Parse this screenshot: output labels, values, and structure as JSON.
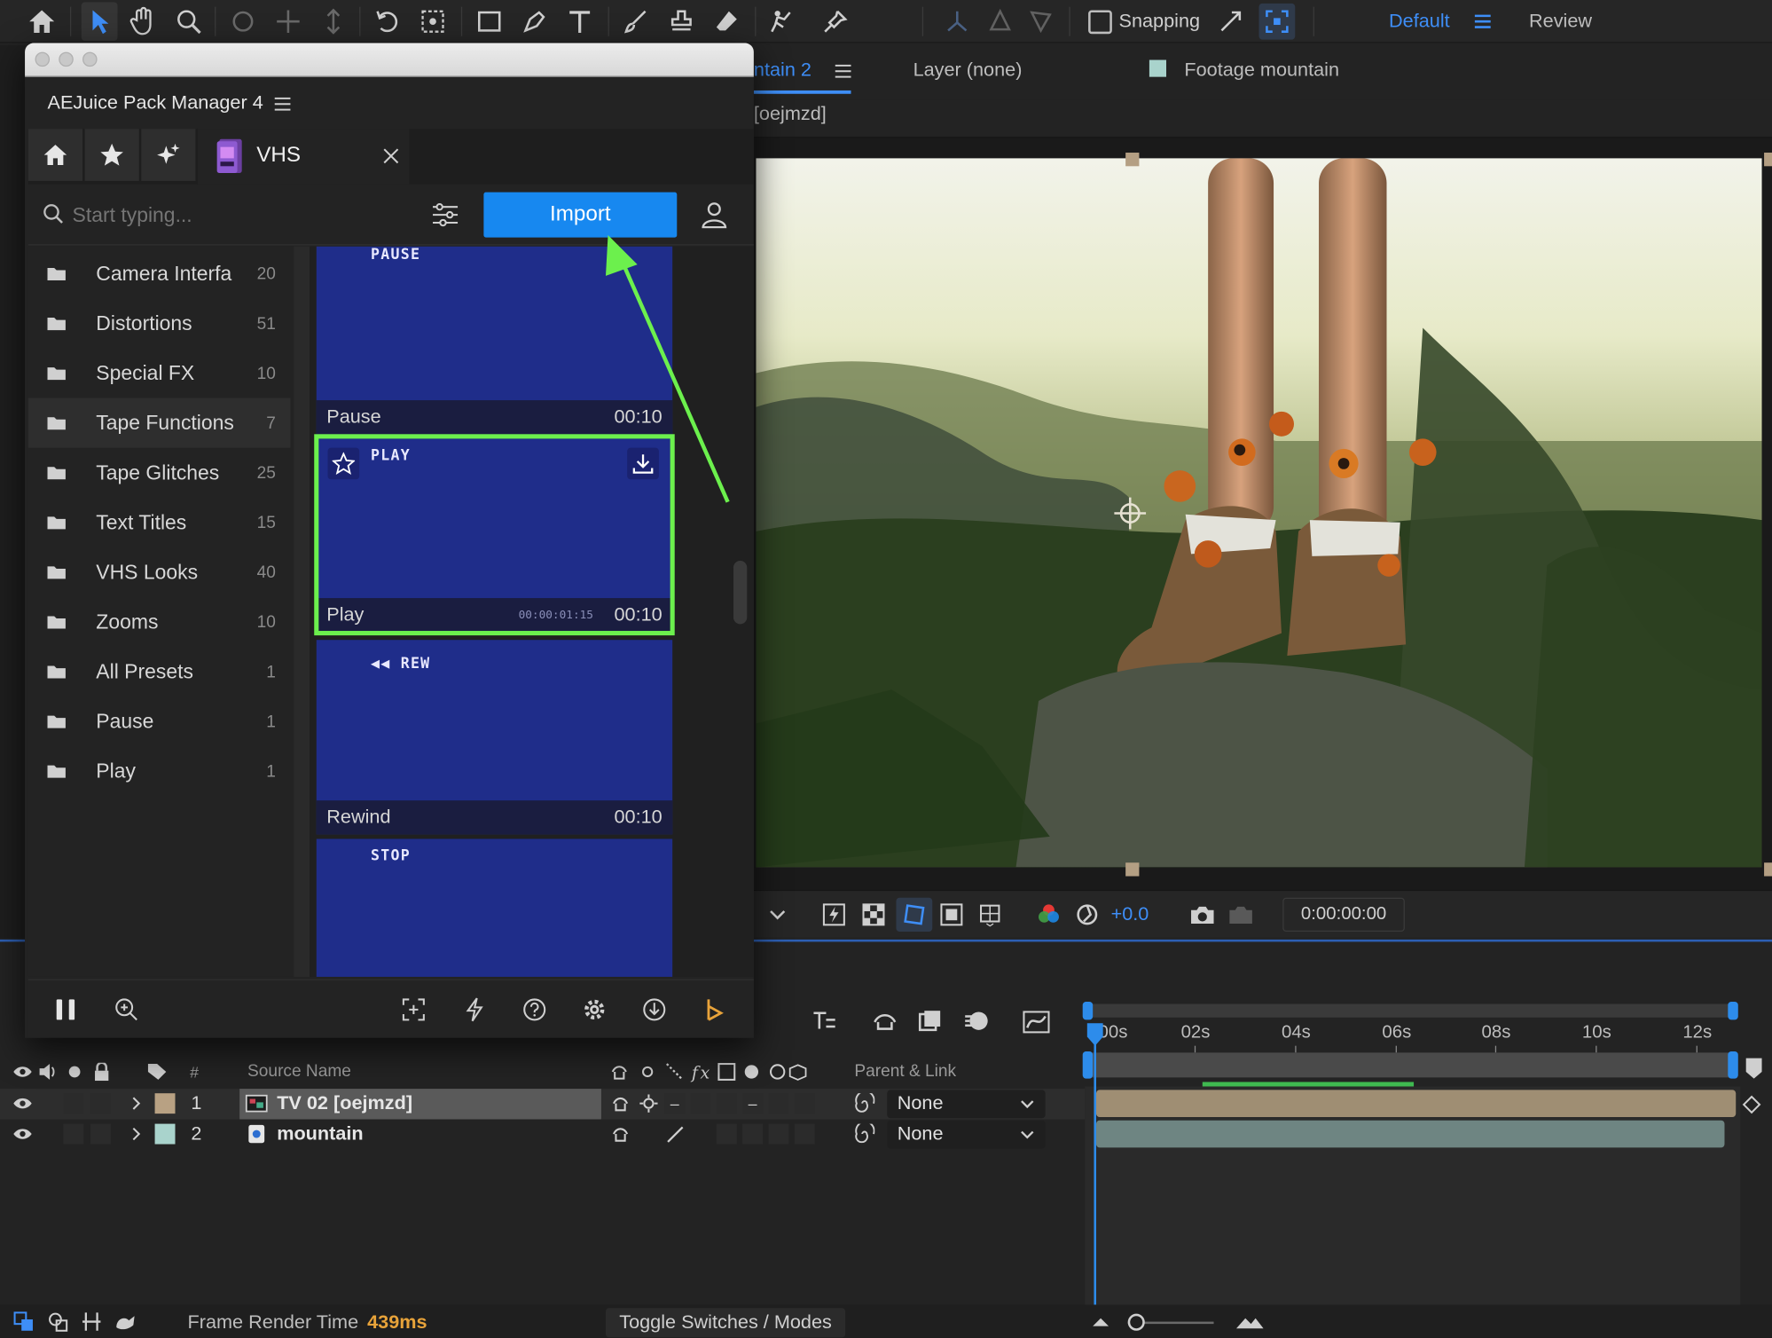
{
  "toolbar": {
    "snapping_label": "Snapping",
    "workspace_default": "Default",
    "workspace_review": "Review"
  },
  "comp": {
    "tab_name": "ntain 2",
    "layer_tab": "Layer (none)",
    "footage_tab": "Footage mountain",
    "sub_label": "[oejmzd]"
  },
  "viewer": {
    "exposure": "+0.0",
    "timecode": "0:00:00:00"
  },
  "plugin": {
    "title": "AEJuice Pack Manager 4",
    "pack_tab": "VHS",
    "search_placeholder": "Start typing...",
    "import_label": "Import",
    "categories": [
      {
        "name": "Camera Interfa",
        "count": "20"
      },
      {
        "name": "Distortions",
        "count": "51"
      },
      {
        "name": "Special FX",
        "count": "10"
      },
      {
        "name": "Tape Functions",
        "count": "7"
      },
      {
        "name": "Tape Glitches",
        "count": "25"
      },
      {
        "name": "Text Titles",
        "count": "15"
      },
      {
        "name": "VHS Looks",
        "count": "40"
      },
      {
        "name": "Zooms",
        "count": "10"
      },
      {
        "name": "All Presets",
        "count": "1"
      },
      {
        "name": "Pause",
        "count": "1"
      },
      {
        "name": "Play",
        "count": "1"
      }
    ],
    "presets": [
      {
        "overlay": "PAUSE",
        "name": "Pause",
        "duration": "00:10"
      },
      {
        "overlay": "PLAY",
        "name": "Play",
        "duration": "00:10",
        "small_tc": "00:00:01:15"
      },
      {
        "overlay": "◀◀ REW",
        "name": "Rewind",
        "duration": "00:10"
      },
      {
        "overlay": "STOP",
        "name": "",
        "duration": ""
      }
    ]
  },
  "timeline": {
    "col_hash": "#",
    "col_source": "Source Name",
    "col_parent": "Parent & Link",
    "ruler": [
      "00s",
      "02s",
      "04s",
      "06s",
      "08s",
      "10s",
      "12s"
    ],
    "layers": [
      {
        "num": "1",
        "name": "TV 02 [oejmzd]",
        "parent": "None",
        "color": "#b8a183"
      },
      {
        "num": "2",
        "name": "mountain",
        "parent": "None",
        "color": "#a9d3cc"
      }
    ],
    "render_label": "Frame Render Time",
    "render_value": "439ms",
    "toggle_label": "Toggle Switches / Modes"
  },
  "colors": {
    "accent_blue": "#2d8ceb",
    "import_blue": "#1788f0",
    "highlight_green": "#6cf04d",
    "card_blue": "#1f2d8a",
    "orange": "#e8a33a"
  }
}
